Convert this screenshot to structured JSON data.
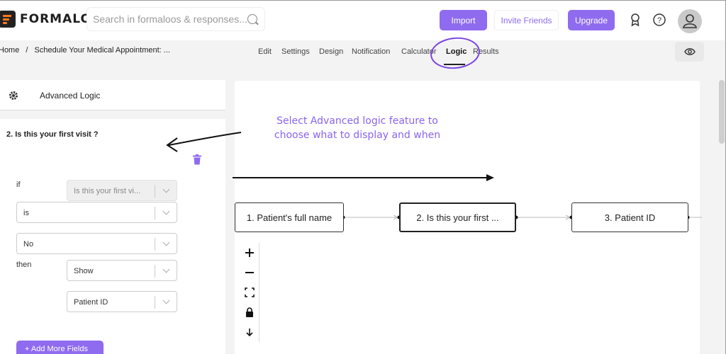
{
  "app": {
    "brand": "FORMALOO",
    "accent": "#8f6bf0"
  },
  "search": {
    "placeholder": "Search in formaloos & responses..."
  },
  "header": {
    "import_label": "Import",
    "invite_label": "Invite Friends",
    "upgrade_label": "Upgrade",
    "icons": [
      "badge-icon",
      "help-icon",
      "user-icon"
    ]
  },
  "breadcrumb": {
    "home": "Home",
    "separator": "/",
    "current": "Schedule Your Medical Appointment: ..."
  },
  "tabs": [
    "Edit",
    "Settings",
    "Design",
    "Notification",
    "Calculator",
    "Logic",
    "Results"
  ],
  "active_tab": "Logic",
  "sidebar": {
    "header_title": "Advanced Logic",
    "question_title": "2. Is this your first visit ?",
    "if_label": "if",
    "then_label": "then",
    "if_field": "Is this your first vi...",
    "operator": "is",
    "value": "No",
    "action": "Show",
    "target_field": "Patient ID",
    "add_label": "+ Add More Fields"
  },
  "annotation": {
    "text": "Select Advanced logic feature to choose what to display and when",
    "color": "#8a63ee"
  },
  "flow": {
    "nodes": [
      "1. Patient's full name",
      "2. Is this your first ...",
      "3. Patient ID"
    ]
  },
  "canvas_controls": [
    "zoom-in-icon",
    "zoom-out-icon",
    "fit-view-icon",
    "lock-icon",
    "arrow-down-icon"
  ]
}
